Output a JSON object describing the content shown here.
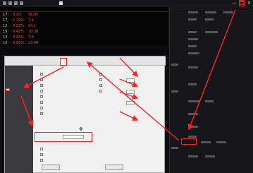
{
  "window": {
    "title": "",
    "controls": [
      "—",
      "□",
      "✕"
    ]
  },
  "grid": {
    "headers": [
      "",
      "",
      "",
      "",
      "",
      "",
      "",
      "",
      ""
    ],
    "rows": [
      {
        "cells": [
          "17",
          "0.1%",
          "56.87",
          "…",
          "…",
          "…",
          "…",
          "…",
          "…"
        ]
      },
      {
        "cells": [
          "17",
          "2.19%",
          "7.1",
          "…",
          "…",
          "…",
          "…",
          "…",
          "…"
        ]
      },
      {
        "cells": [
          "12",
          "0.22%",
          "34.1",
          "…",
          "…",
          "…",
          "…",
          "…",
          "…"
        ]
      },
      {
        "cells": [
          "15",
          "0.42%",
          "10.30",
          "…",
          "…",
          "…",
          "…",
          "…",
          "…"
        ]
      },
      {
        "cells": [
          "12",
          "0.05%",
          "7.8",
          "…",
          "…",
          "…",
          "…",
          "…",
          "…"
        ]
      },
      {
        "cells": [
          "12",
          "0.35%",
          "23.40",
          "…",
          "…",
          "…",
          "…",
          "…",
          "…"
        ]
      }
    ]
  },
  "right_panel": {
    "items": [
      "",
      "",
      "",
      "",
      "",
      "",
      "",
      ""
    ]
  },
  "dialog": {
    "tabs": [
      "",
      "",
      "",
      ""
    ],
    "active_tab": "",
    "left_items": [
      "",
      "",
      "",
      "",
      "",
      ""
    ],
    "selected_left": "",
    "options": [
      "",
      "",
      "",
      "",
      "",
      "",
      "",
      ""
    ],
    "buttons": [
      "",
      ""
    ]
  },
  "colors": {
    "highlight": "#ff2222",
    "up": "#ff3b3b",
    "yellow": "#e6e02a"
  }
}
